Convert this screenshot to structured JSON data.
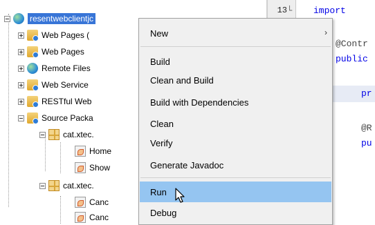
{
  "tree": {
    "root": {
      "label": "resentwebclientjc",
      "selected": true
    },
    "items": [
      {
        "label": "Web Pages (",
        "icon": "folder-globe-icon"
      },
      {
        "label": "Web Pages",
        "icon": "folder-globe-icon"
      },
      {
        "label": "Remote Files",
        "icon": "globe-icon"
      },
      {
        "label": "Web Service",
        "icon": "folder-service-icon"
      },
      {
        "label": "RESTful Web",
        "icon": "folder-rest-icon"
      },
      {
        "label": "Source Packa",
        "icon": "folder-source-icon"
      }
    ],
    "packages": [
      {
        "label": "cat.xtec.",
        "children": [
          "Home",
          "Show"
        ]
      },
      {
        "label": "cat.xtec.",
        "children": [
          "Canc",
          "Canc"
        ]
      }
    ]
  },
  "editor": {
    "line_number": "13",
    "fold_mark": "└",
    "lines": [
      {
        "text": "import",
        "kind": "keyword"
      },
      {
        "text": "@Contr",
        "kind": "annotation"
      },
      {
        "text": "public",
        "kind": "keyword"
      },
      {
        "text": "pr",
        "kind": "keyword"
      },
      {
        "text": "@R",
        "kind": "annotation"
      },
      {
        "text": "pu",
        "kind": "keyword"
      }
    ]
  },
  "context_menu": {
    "items": [
      {
        "label": "New",
        "has_submenu": true
      },
      {
        "label": "Build"
      },
      {
        "label": "Clean and Build"
      },
      {
        "label": "Build with Dependencies"
      },
      {
        "label": "Clean"
      },
      {
        "label": "Verify"
      },
      {
        "label": "Generate Javadoc"
      },
      {
        "label": "Run",
        "hovered": true
      },
      {
        "label": "Debug"
      }
    ],
    "submenu_arrow": "›",
    "hover_color": "#95c5f1"
  },
  "colors": {
    "selection": "#3875d7",
    "keyword": "#0000e6",
    "menu_bg": "#f0f0f0"
  }
}
